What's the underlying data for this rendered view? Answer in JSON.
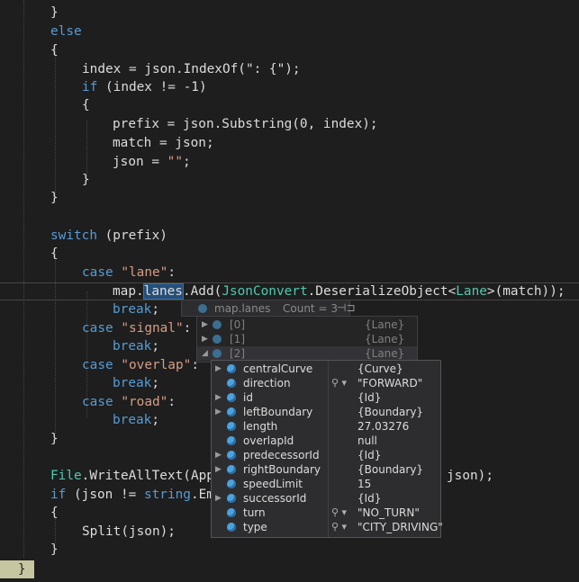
{
  "code": {
    "line_0": "}",
    "line_1_kw": "else",
    "line_2": "{",
    "line_3": "index = json.IndexOf(\": {\");",
    "line_4_kw": "if",
    "line_4_rest": " (index != -1)",
    "line_5": "{",
    "line_6": "prefix = json.Substring(0, index);",
    "line_7": "match = json;",
    "line_8_a": "json = ",
    "line_8_s": "\"\"",
    "line_8_b": ";",
    "line_9": "}",
    "line_10": "}",
    "line_12_kw": "switch",
    "line_12_rest": " (prefix)",
    "line_13": "{",
    "case_kw": "case",
    "case_lane": "\"lane\"",
    "colon": ":",
    "map_prefix": "map.",
    "lanes_word": "lanes",
    "add_call": ".Add(",
    "jsonconvert": "JsonConvert",
    "deser": ".DeserializeObject<",
    "lane_type": "Lane",
    "match_tail": ">(match));",
    "break_kw": "break",
    "semicolon": ";",
    "case_signal": "\"signal\"",
    "case_overlap": "\"overlap\"",
    "case_road": "\"road\"",
    "close_brace": "}",
    "file_type": "File",
    "write_all": ".WriteAllText(",
    "app_frag": "App",
    "json_end": "json);",
    "if_kw": "if",
    "if_json": " (json != ",
    "string_kw": "string",
    "em_frag": ".Em",
    "open_brace": "{",
    "split_call": "Split(json);",
    "final_brace": "}"
  },
  "datatip": {
    "expr": "map.lanes",
    "count": "Count = 3",
    "pin_icon": "pin-icon",
    "lanes": [
      {
        "name": "[0]",
        "value": "{Lane}"
      },
      {
        "name": "[1]",
        "value": "{Lane}"
      },
      {
        "name": "[2]",
        "value": "{Lane}"
      }
    ],
    "properties": [
      {
        "name": "centralCurve",
        "value": "{Curve}",
        "expandable": true,
        "magnifier": false
      },
      {
        "name": "direction",
        "value": "\"FORWARD\"",
        "expandable": false,
        "magnifier": true
      },
      {
        "name": "id",
        "value": "{Id}",
        "expandable": true,
        "magnifier": false
      },
      {
        "name": "leftBoundary",
        "value": "{Boundary}",
        "expandable": true,
        "magnifier": false
      },
      {
        "name": "length",
        "value": "27.03276",
        "expandable": false,
        "magnifier": false
      },
      {
        "name": "overlapId",
        "value": "null",
        "expandable": false,
        "magnifier": false
      },
      {
        "name": "predecessorId",
        "value": "{Id}",
        "expandable": true,
        "magnifier": false
      },
      {
        "name": "rightBoundary",
        "value": "{Boundary}",
        "expandable": true,
        "magnifier": false
      },
      {
        "name": "speedLimit",
        "value": "15",
        "expandable": false,
        "magnifier": false
      },
      {
        "name": "successorId",
        "value": "{Id}",
        "expandable": true,
        "magnifier": false
      },
      {
        "name": "turn",
        "value": "\"NO_TURN\"",
        "expandable": false,
        "magnifier": true
      },
      {
        "name": "type",
        "value": "\"CITY_DRIVING\"",
        "expandable": false,
        "magnifier": true
      }
    ],
    "glyphs": {
      "expand": "▶",
      "expanded": "◢",
      "magnifier": "⚲ ▾"
    }
  },
  "colors": {
    "keyword": "#569cd6",
    "string": "#d69d85",
    "type": "#4ec9b0",
    "text": "#dcdcdc",
    "background": "#1e1e1e"
  }
}
